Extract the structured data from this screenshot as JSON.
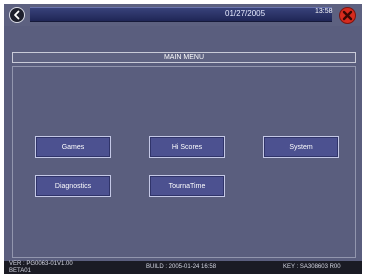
{
  "header": {
    "date": "01/27/2005",
    "time": "13:58"
  },
  "main_menu": {
    "title": "MAIN MENU",
    "buttons": [
      {
        "label": "Games"
      },
      {
        "label": "Hi Scores"
      },
      {
        "label": "System"
      },
      {
        "label": "Diagnostics"
      },
      {
        "label": "TournaTime"
      }
    ]
  },
  "footer": {
    "version": "VER : PG0063-01V1.00",
    "version_line2": "BETA01",
    "build": "BUILD : 2005-01-24 16:58",
    "key": "KEY : SA308603 R00"
  },
  "colors": {
    "background": "#5a5e7e",
    "button": "#4c5190",
    "close": "#d62b1e"
  },
  "icons": {
    "back": "back-arrow-icon",
    "close": "close-x-icon"
  }
}
